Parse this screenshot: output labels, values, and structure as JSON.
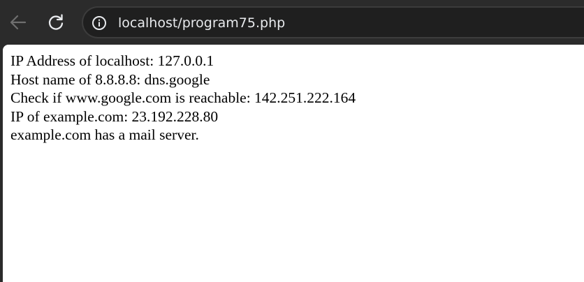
{
  "browser": {
    "url": "localhost/program75.php",
    "icons": {
      "back": "arrow-left-icon",
      "reload": "reload-icon",
      "site_info": "info-icon"
    },
    "colors": {
      "chrome": "#2b2b2b",
      "omnibox": "#1f1f1f",
      "url_text": "#e8eaed",
      "disabled_icon": "#6f6f6f",
      "active_icon": "#e8eaed"
    }
  },
  "page": {
    "lines": [
      "IP Address of localhost: 127.0.0.1",
      "Host name of 8.8.8.8: dns.google",
      "Check if www.google.com is reachable: 142.251.222.164",
      "IP of example.com: 23.192.228.80",
      "example.com has a mail server."
    ]
  }
}
